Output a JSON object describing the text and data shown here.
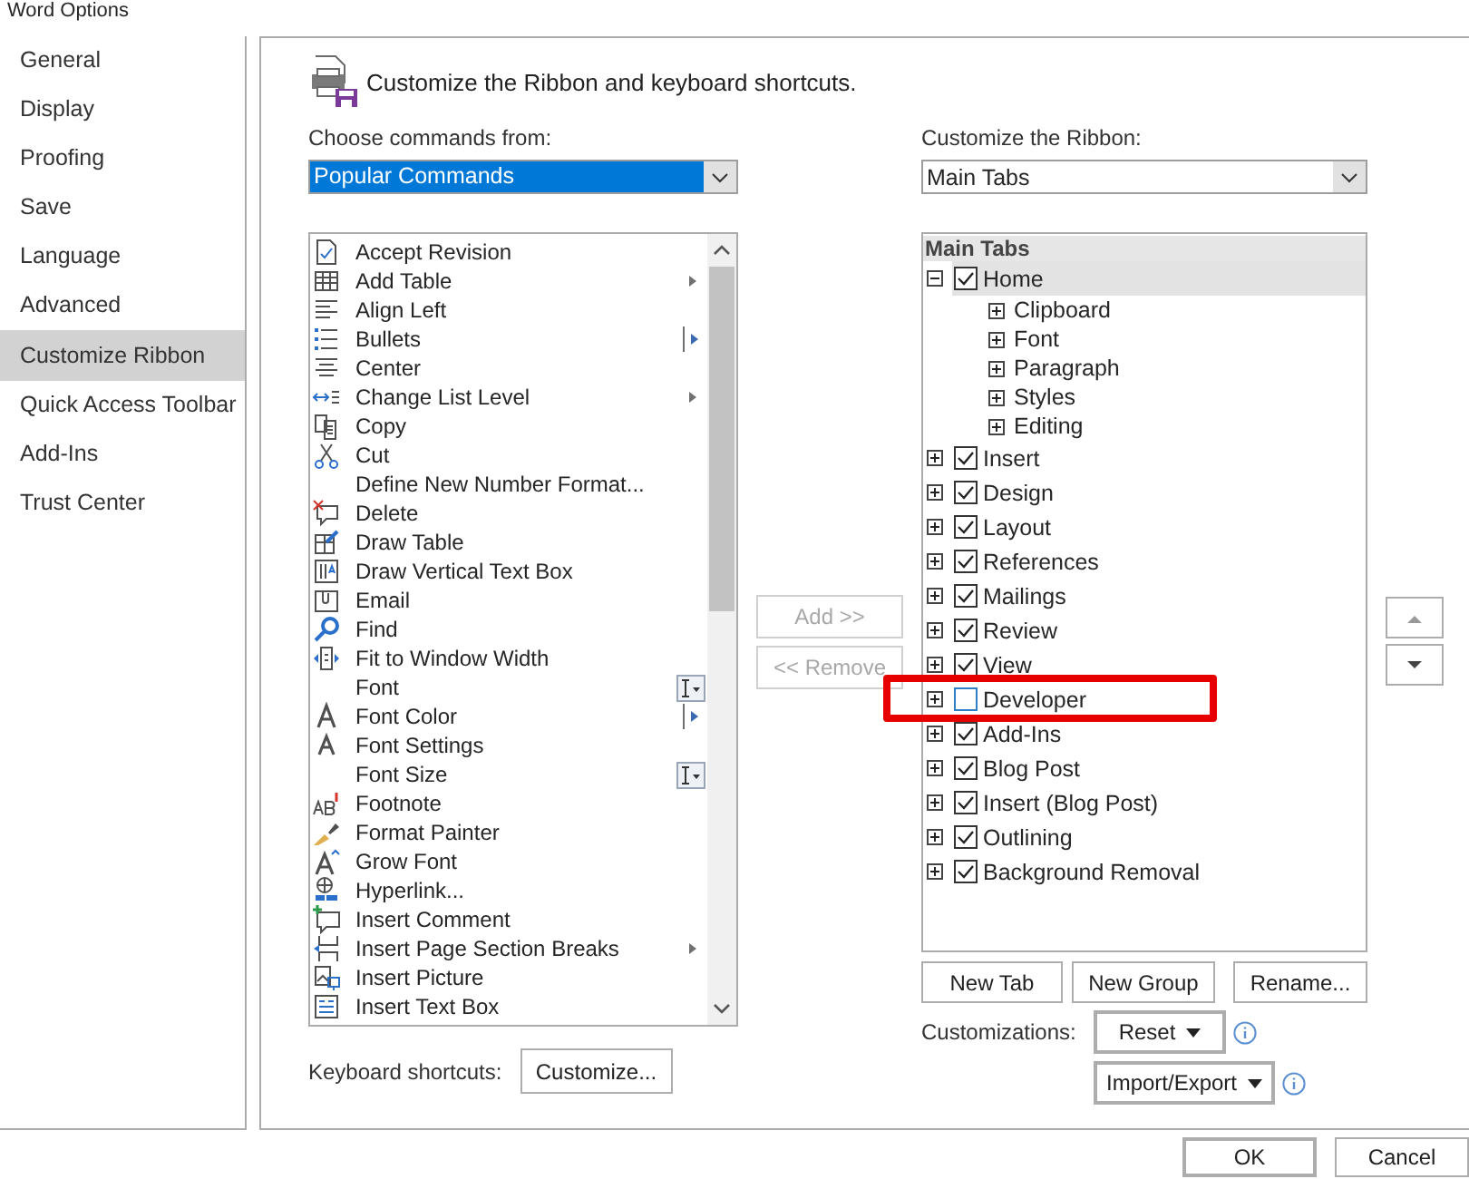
{
  "window": {
    "title": "Word Options"
  },
  "sidebar": {
    "items": [
      {
        "label": "General",
        "selected": false
      },
      {
        "label": "Display",
        "selected": false
      },
      {
        "label": "Proofing",
        "selected": false
      },
      {
        "label": "Save",
        "selected": false
      },
      {
        "label": "Language",
        "selected": false
      },
      {
        "label": "Advanced",
        "selected": false
      },
      {
        "label": "Customize Ribbon",
        "selected": true
      },
      {
        "label": "Quick Access Toolbar",
        "selected": false
      },
      {
        "label": "Add-Ins",
        "selected": false
      },
      {
        "label": "Trust Center",
        "selected": false
      }
    ]
  },
  "header": {
    "title": "Customize the Ribbon and keyboard shortcuts."
  },
  "commands": {
    "label": "Choose commands from:",
    "dropdown": {
      "value": "Popular Commands"
    },
    "items": [
      {
        "label": "Accept Revision",
        "kind": "plain"
      },
      {
        "label": "Add Table",
        "kind": "submenu"
      },
      {
        "label": "Align Left",
        "kind": "plain"
      },
      {
        "label": "Bullets",
        "kind": "split"
      },
      {
        "label": "Center",
        "kind": "plain"
      },
      {
        "label": "Change List Level",
        "kind": "submenu"
      },
      {
        "label": "Copy",
        "kind": "plain"
      },
      {
        "label": "Cut",
        "kind": "plain"
      },
      {
        "label": "Define New Number Format...",
        "kind": "plain"
      },
      {
        "label": "Delete",
        "kind": "plain"
      },
      {
        "label": "Draw Table",
        "kind": "plain"
      },
      {
        "label": "Draw Vertical Text Box",
        "kind": "plain"
      },
      {
        "label": "Email",
        "kind": "plain"
      },
      {
        "label": "Find",
        "kind": "plain"
      },
      {
        "label": "Fit to Window Width",
        "kind": "plain"
      },
      {
        "label": "Font",
        "kind": "field"
      },
      {
        "label": "Font Color",
        "kind": "split"
      },
      {
        "label": "Font Settings",
        "kind": "plain"
      },
      {
        "label": "Font Size",
        "kind": "field"
      },
      {
        "label": "Footnote",
        "kind": "plain"
      },
      {
        "label": "Format Painter",
        "kind": "plain"
      },
      {
        "label": "Grow Font",
        "kind": "plain"
      },
      {
        "label": "Hyperlink...",
        "kind": "plain"
      },
      {
        "label": "Insert Comment",
        "kind": "plain"
      },
      {
        "label": "Insert Page  Section Breaks",
        "kind": "submenu"
      },
      {
        "label": "Insert Picture",
        "kind": "plain"
      },
      {
        "label": "Insert Text Box",
        "kind": "plain"
      }
    ]
  },
  "transfer_buttons": [
    {
      "label": "Add >>",
      "disabled": true
    },
    {
      "label": "<< Remove",
      "disabled": true
    }
  ],
  "ribbon": {
    "label": "Customize the Ribbon:",
    "dropdown": {
      "value": "Main Tabs"
    },
    "tree": {
      "header": "Main Tabs",
      "items": [
        {
          "label": "Home",
          "checked": true,
          "expanded": true,
          "selected": true,
          "highlighted": false,
          "children": [
            {
              "label": "Clipboard",
              "expanded": false
            },
            {
              "label": "Font",
              "expanded": false
            },
            {
              "label": "Paragraph",
              "expanded": false
            },
            {
              "label": "Styles",
              "expanded": false
            },
            {
              "label": "Editing",
              "expanded": false
            }
          ]
        },
        {
          "label": "Insert",
          "checked": true,
          "expanded": false,
          "selected": false,
          "highlighted": false
        },
        {
          "label": "Design",
          "checked": true,
          "expanded": false,
          "selected": false,
          "highlighted": false
        },
        {
          "label": "Layout",
          "checked": true,
          "expanded": false,
          "selected": false,
          "highlighted": false
        },
        {
          "label": "References",
          "checked": true,
          "expanded": false,
          "selected": false,
          "highlighted": false
        },
        {
          "label": "Mailings",
          "checked": true,
          "expanded": false,
          "selected": false,
          "highlighted": false
        },
        {
          "label": "Review",
          "checked": true,
          "expanded": false,
          "selected": false,
          "highlighted": false
        },
        {
          "label": "View",
          "checked": true,
          "expanded": false,
          "selected": false,
          "highlighted": false
        },
        {
          "label": "Developer",
          "checked": false,
          "expanded": false,
          "selected": false,
          "highlighted": true
        },
        {
          "label": "Add-Ins",
          "checked": true,
          "expanded": false,
          "selected": false,
          "highlighted": false
        },
        {
          "label": "Blog Post",
          "checked": true,
          "expanded": false,
          "selected": false,
          "highlighted": false
        },
        {
          "label": "Insert (Blog Post)",
          "checked": true,
          "expanded": false,
          "selected": false,
          "highlighted": false
        },
        {
          "label": "Outlining",
          "checked": true,
          "expanded": false,
          "selected": false,
          "highlighted": false
        },
        {
          "label": "Background Removal",
          "checked": true,
          "expanded": false,
          "selected": false,
          "highlighted": false
        }
      ]
    },
    "buttons": [
      {
        "label": "New Tab"
      },
      {
        "label": "New Group"
      },
      {
        "label": "Rename..."
      }
    ]
  },
  "customizations": {
    "label": "Customizations:",
    "buttons": [
      {
        "label": "Reset"
      },
      {
        "label": "Import/Export"
      }
    ]
  },
  "keyboard": {
    "label": "Keyboard shortcuts:",
    "button": "Customize..."
  },
  "footer": {
    "buttons": [
      {
        "label": "OK",
        "default": true
      },
      {
        "label": "Cancel",
        "default": false
      }
    ]
  }
}
